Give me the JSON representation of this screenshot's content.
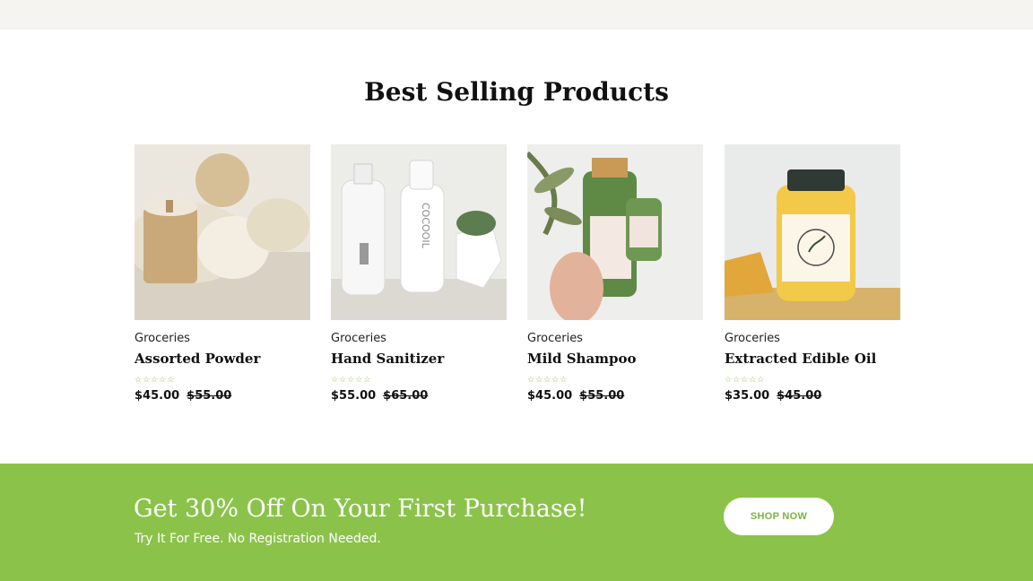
{
  "section": {
    "title": "Best Selling Products"
  },
  "products": [
    {
      "category": "Groceries",
      "name": "Assorted Powder",
      "rating": 0,
      "price": "$45.00",
      "old_price": "$55.00",
      "image": "bamboo-jars-photo"
    },
    {
      "category": "Groceries",
      "name": "Hand Sanitizer",
      "rating": 0,
      "price": "$55.00",
      "old_price": "$65.00",
      "image": "cocooil-bottle-photo"
    },
    {
      "category": "Groceries",
      "name": "Mild Shampoo",
      "rating": 0,
      "price": "$45.00",
      "old_price": "$55.00",
      "image": "green-shampoo-bottle-photo"
    },
    {
      "category": "Groceries",
      "name": "Extracted Edible Oil",
      "rating": 0,
      "price": "$35.00",
      "old_price": "$45.00",
      "image": "yellow-oil-jar-photo"
    }
  ],
  "promo": {
    "heading": "Get 30% Off On Your First Purchase!",
    "subtext": "Try It For Free. No Registration Needed.",
    "button": "SHOP NOW"
  },
  "colors": {
    "accent": "#8bc34a",
    "top_strip": "#f5f4f0",
    "button_text": "#7bb342"
  }
}
